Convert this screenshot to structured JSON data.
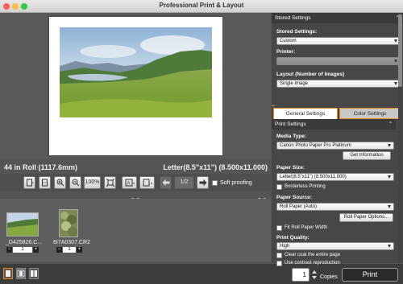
{
  "window": {
    "title": "Professional Print & Layout"
  },
  "preview": {
    "media_size": "44 in Roll (1117.6mm)",
    "paper_size": "Letter(8.5\"x11\") (8.500x11.000)"
  },
  "toolbar": {
    "zoom_level": "100%",
    "page_indicator": "1/2",
    "soft_proofing_label": "Soft proofing"
  },
  "thumbnails": [
    {
      "name": "_D425826.C...",
      "copies": "1"
    },
    {
      "name": "6I7A0307.CR2",
      "copies": "1"
    }
  ],
  "bottom": {
    "copies_value": "1",
    "copies_label": "Copies",
    "print_label": "Print"
  },
  "settings": {
    "stored_header": "Stored Settings",
    "stored_label": "Stored Settings:",
    "stored_value": "Custom",
    "printer_label": "Printer:",
    "printer_value": "",
    "layout_label": "Layout (Number of Images)",
    "layout_value": "Single Image",
    "tabs": [
      "General Settings",
      "Color Settings"
    ],
    "print_settings_header": "Print Settings",
    "media_type_label": "Media Type:",
    "media_type_value": "Canon Photo Paper Pro Platinum",
    "get_information_label": "Get Information",
    "paper_size_label": "Paper Size:",
    "paper_size_value": "Letter(8.5\"x11\") (8.500x11.000)",
    "borderless_label": "Borderless Printing",
    "paper_source_label": "Paper Source:",
    "paper_source_value": "Roll Paper (Auto)",
    "roll_paper_options_label": "Roll Paper Options...",
    "fit_roll_label": "Fit Roll Paper Width",
    "print_quality_label": "Print Quality:",
    "print_quality_value": "High",
    "clear_coat_label": "Clear coat the entire page",
    "contrast_label": "Use contrast reproduction"
  },
  "colors": {
    "accent": "#e88a1a",
    "close": "#fc605b",
    "minimize": "#fdbc40",
    "zoom": "#34c84a"
  }
}
